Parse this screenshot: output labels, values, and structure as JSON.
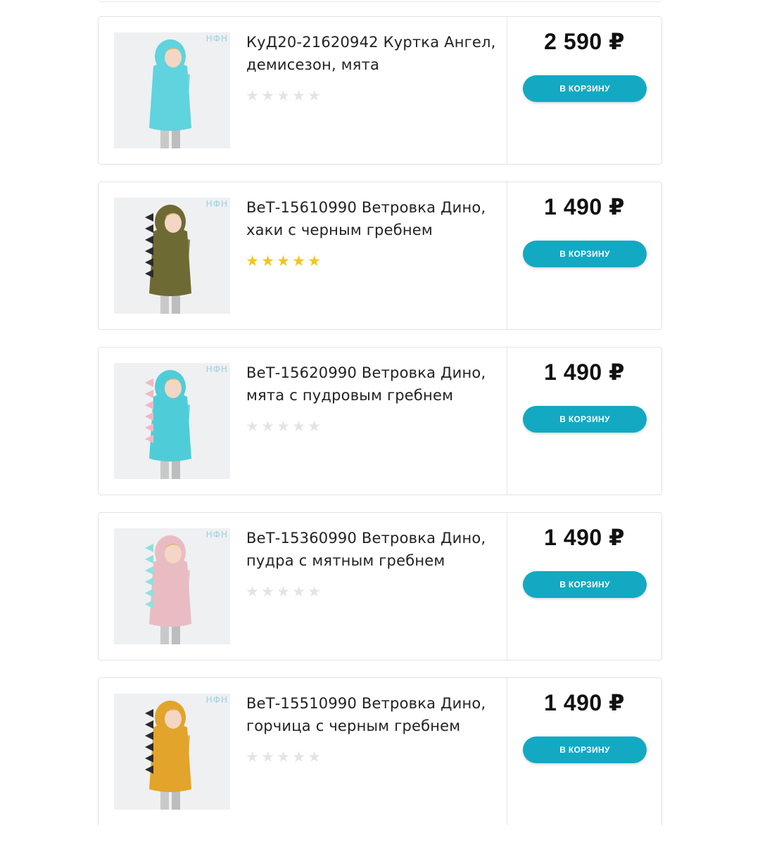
{
  "brand_mark": "НФН",
  "button_label": "В КОРЗИНУ",
  "colors": {
    "accent": "#13a9c3",
    "star_on": "#f6c51a",
    "star_off": "#e4e4e4"
  },
  "products": [
    {
      "title": "КуД20-21620942 Куртка Ангел, демисезон, мята",
      "price": "2 590 ₽",
      "rating": 0,
      "image": "girl-in-mint-jacket",
      "garment_color": "#5fd3de"
    },
    {
      "title": "ВеТ-15610990 Ветровка Дино, хаки с черным гребнем",
      "price": "1 490 ₽",
      "rating": 5,
      "image": "boy-in-khaki-dino-windbreaker",
      "garment_color": "#6e6a34"
    },
    {
      "title": "ВеТ-15620990 Ветровка Дино, мята с пудровым гребнем",
      "price": "1 490 ₽",
      "rating": 0,
      "image": "girl-in-mint-dino-windbreaker",
      "garment_color": "#4ecdd8"
    },
    {
      "title": "ВеТ-15360990 Ветровка Дино, пудра с мятным гребнем",
      "price": "1 490 ₽",
      "rating": 0,
      "image": "girl-in-powder-dino-windbreaker",
      "garment_color": "#e9bcc4"
    },
    {
      "title": "ВеТ-15510990 Ветровка Дино, горчица с черным гребнем",
      "price": "1 490 ₽",
      "rating": 0,
      "image": "child-in-mustard-dino-windbreaker",
      "garment_color": "#e2a42a"
    }
  ]
}
